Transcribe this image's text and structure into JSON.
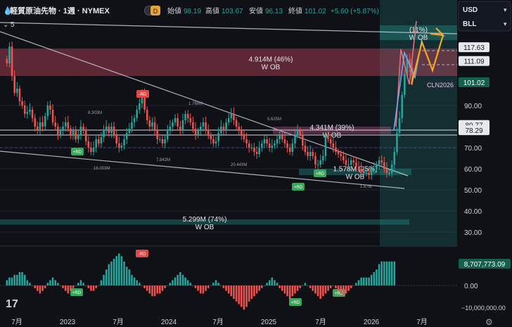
{
  "header": {
    "symbol_icon": "droplet-icon",
    "title": "軽質原油先物 · 1週 · NYMEX",
    "badge": "D",
    "open_label": "始値",
    "open": "98.19",
    "high_label": "高値",
    "high": "103.67",
    "low_label": "安値",
    "low": "96.13",
    "close_label": "終値",
    "close": "101.02",
    "change": "+5.60 (+5.87%)",
    "indicator_count": "5"
  },
  "top_right": {
    "currency": "USD",
    "unit": "BLL"
  },
  "colors": {
    "bg": "#0f1117",
    "up": "#26a69a",
    "down": "#ef5350",
    "ob_red": "#f04f6f",
    "ob_teal": "#2ab3a4",
    "pink_zone": "#f06aa8",
    "orange_arrow": "#f5a623",
    "tag_red": "#e04848",
    "tag_green": "#3ba55c",
    "grid": "#1f2430"
  },
  "price_axis": {
    "ticks": [
      "90.00",
      "70.00",
      "60.00",
      "50.00",
      "40.00",
      "30.00"
    ],
    "tick_values": [
      90,
      70,
      60,
      50,
      40,
      30
    ],
    "markers": [
      {
        "label": "117.63",
        "value": 117.63,
        "style": "white"
      },
      {
        "label": "111.09",
        "value": 111.09,
        "style": "white"
      },
      {
        "label": "101.02",
        "value": 101.02,
        "style": "teal"
      },
      {
        "label": "80.77",
        "value": 80.77,
        "style": "white"
      },
      {
        "label": "78.29",
        "value": 78.29,
        "style": "white"
      }
    ],
    "symbol_tag": "CLN2026"
  },
  "volume_axis": {
    "ticks": [
      "0.00",
      "−10,000,000.00"
    ],
    "current": "8,707,773.09"
  },
  "time_axis": [
    "7月",
    "2023",
    "7月",
    "2024",
    "7月",
    "2025",
    "7月",
    "2026",
    "7月"
  ],
  "order_blocks": [
    {
      "label": "4.914M (46%)",
      "sub": "W OB",
      "top": 117,
      "bottom": 104,
      "color": "red"
    },
    {
      "label": "4.341M (39%)",
      "sub": "W OB",
      "top": 80,
      "bottom": 76.5,
      "color": "pink"
    },
    {
      "label": "1.578M (25%)",
      "sub": "W OB",
      "top": 60,
      "bottom": 57,
      "color": "teal"
    },
    {
      "label": "5.299M (74%)",
      "sub": "W OB",
      "top": 36,
      "bottom": 33.5,
      "color": "teal"
    },
    {
      "label": "(11%)",
      "sub": "W OB",
      "top": 128,
      "bottom": 121,
      "color": "teal"
    }
  ],
  "small_labels": [
    "8.303M",
    "1.768M",
    "5.625M",
    "16.003M",
    "7.842M",
    "20.443M",
    "1.87M"
  ],
  "tags": [
    {
      "label": "-RD",
      "type": "red"
    },
    {
      "label": "+RD",
      "type": "green"
    },
    {
      "label": "+RD",
      "type": "green"
    },
    {
      "label": "+RD",
      "type": "green"
    },
    {
      "label": "-RD",
      "type": "red"
    },
    {
      "label": "+RD",
      "type": "green"
    },
    {
      "label": "+RD",
      "type": "green"
    },
    {
      "label": "+RD",
      "type": "green"
    }
  ],
  "chart_data": {
    "type": "candlestick",
    "timeframe": "1W",
    "x_range": [
      "2022-06",
      "2026-07"
    ],
    "ylim": [
      25,
      130
    ],
    "weekly_closes": [
      110,
      118,
      104,
      96,
      98,
      92,
      90,
      86,
      87,
      88,
      84,
      80,
      78,
      82,
      80,
      85,
      90,
      88,
      82,
      80,
      76,
      78,
      80,
      82,
      79,
      76,
      78,
      74,
      76,
      80,
      78,
      73,
      70,
      68,
      70,
      74,
      72,
      75,
      78,
      80,
      77,
      80,
      76,
      72,
      70,
      71,
      74,
      77,
      79,
      82,
      84,
      88,
      91,
      95,
      88,
      83,
      80,
      82,
      78,
      74,
      74,
      72,
      74,
      78,
      80,
      82,
      84,
      80,
      78,
      83,
      86,
      84,
      82,
      79,
      76,
      78,
      80,
      82,
      78,
      76,
      74,
      72,
      73,
      77,
      80,
      78,
      82,
      84,
      86,
      83,
      80,
      78,
      76,
      74,
      72,
      70,
      70,
      68,
      67,
      70,
      72,
      74,
      72,
      70,
      71,
      72,
      74,
      76,
      74,
      72,
      70,
      68,
      72,
      76,
      78,
      76,
      71,
      68,
      66,
      68,
      66,
      62,
      62,
      64,
      66,
      76,
      74,
      72,
      70,
      68,
      67,
      66,
      64,
      62,
      62,
      64,
      63,
      61,
      60,
      59,
      58,
      58,
      57,
      59,
      60,
      62,
      64,
      63,
      60,
      58,
      58,
      62,
      68,
      77,
      84,
      95,
      105,
      112,
      108,
      101
    ],
    "volume_oscillator": [
      2,
      3,
      3,
      4,
      4,
      5,
      5,
      4,
      2,
      1,
      0,
      -1,
      -2,
      -3,
      -2,
      -1,
      1,
      2,
      3,
      2,
      1,
      0,
      -1,
      -2,
      -3,
      -2,
      -1,
      0,
      1,
      2,
      1,
      0,
      -1,
      -2,
      -2,
      -1,
      0,
      2,
      4,
      6,
      8,
      9,
      10,
      11,
      12,
      11,
      9,
      7,
      6,
      4,
      3,
      2,
      1,
      0,
      -1,
      -2,
      -3,
      -4,
      -4,
      -3,
      -3,
      -2,
      -1,
      0,
      1,
      2,
      3,
      4,
      5,
      4,
      3,
      2,
      1,
      0,
      -1,
      -2,
      -3,
      -3,
      -2,
      -1,
      0,
      1,
      2,
      1,
      0,
      -1,
      -2,
      -3,
      -4,
      -5,
      -6,
      -7,
      -8,
      -9,
      -8,
      -6,
      -5,
      -4,
      -3,
      -2,
      -1,
      0,
      1,
      2,
      3,
      2,
      1,
      -1,
      -2,
      -3,
      -4,
      -5,
      -4,
      -3,
      -2,
      -1,
      0,
      1,
      0,
      -1,
      -2,
      -3,
      -4,
      -5,
      -4,
      -3,
      -2,
      -1,
      0,
      -1,
      -2,
      -3,
      -4,
      -3,
      -2,
      -1,
      0,
      1,
      2,
      3,
      3,
      3,
      3,
      4,
      5,
      6,
      8,
      9,
      9,
      9,
      9,
      9,
      9
    ],
    "last_close": 101.02
  }
}
